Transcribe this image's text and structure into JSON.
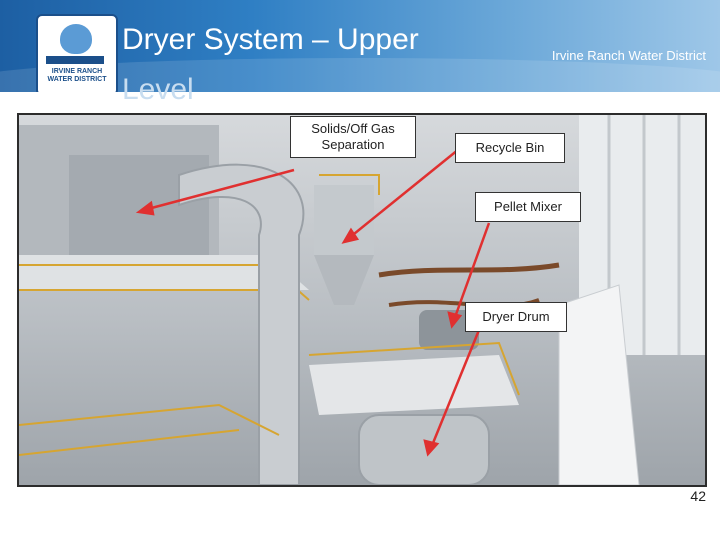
{
  "header": {
    "title": "Dryer System – Upper",
    "title_wrap": "Level",
    "district": "Irvine Ranch Water District"
  },
  "logo": {
    "line1": "IRVINE RANCH",
    "line2": "WATER DISTRICT"
  },
  "callouts": {
    "solids": "Solids/Off Gas Separation",
    "recycle": "Recycle Bin",
    "pellet": "Pellet Mixer",
    "drum": "Dryer Drum"
  },
  "page_number": "42",
  "colors": {
    "accent": "#2f7fc4",
    "arrow": "#e03030"
  }
}
